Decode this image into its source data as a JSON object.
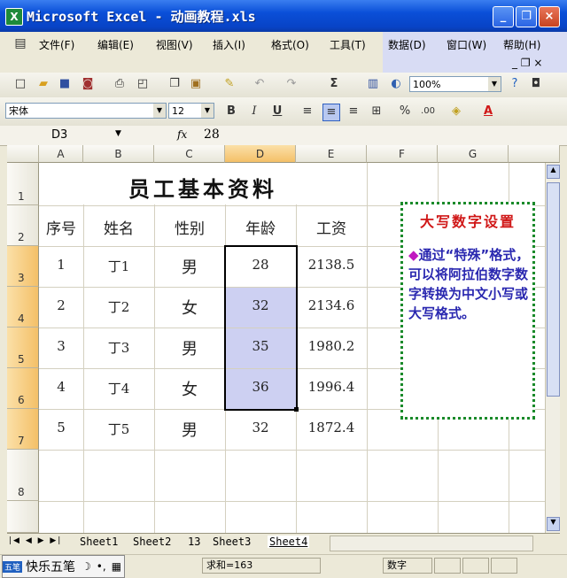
{
  "title": {
    "text": "Microsoft Excel - 动画教程.xls"
  },
  "window_controls": {
    "minimize": "_",
    "restore": "❐",
    "close": "×"
  },
  "menu": {
    "items": [
      "文件(F)",
      "编辑(E)",
      "视图(V)",
      "插入(I)",
      "格式(O)",
      "工具(T)",
      "数据(D)",
      "窗口(W)",
      "帮助(H)"
    ],
    "mdi_controls": "_ ❐ ×"
  },
  "standard_toolbar": {
    "zoom": "100%"
  },
  "format_toolbar": {
    "font": "宋体",
    "size": "12",
    "bold": "B",
    "italic": "I",
    "underline": "U"
  },
  "formula_bar": {
    "cell_ref": "D3",
    "fx": "fx",
    "value": "28"
  },
  "columns": [
    "A",
    "B",
    "C",
    "D",
    "E",
    "F",
    "G"
  ],
  "rows": [
    "1",
    "2",
    "3",
    "4",
    "5",
    "6",
    "7",
    "8"
  ],
  "sheet": {
    "title": "员工基本资料",
    "headers": [
      "序号",
      "姓名",
      "性别",
      "年龄",
      "工资"
    ],
    "records": [
      [
        "1",
        "丁1",
        "男",
        "28",
        "2138.5"
      ],
      [
        "2",
        "丁2",
        "女",
        "32",
        "2134.6"
      ],
      [
        "3",
        "丁3",
        "男",
        "35",
        "1980.2"
      ],
      [
        "4",
        "丁4",
        "女",
        "36",
        "1996.4"
      ],
      [
        "5",
        "丁5",
        "男",
        "32",
        "1872.4"
      ]
    ]
  },
  "note": {
    "title": "大写数字设置",
    "body": "通过“特殊”格式，可以将阿拉伯数字数字转换为中文小写或大写格式。",
    "diamond": "◆"
  },
  "sheet_tabs": [
    "Sheet1",
    "Sheet2",
    "13",
    "Sheet3",
    "Sheet4"
  ],
  "active_tab": "Sheet4",
  "status": {
    "sum": "求和=163",
    "mode": "数字"
  },
  "ime": {
    "label": "快乐五笔"
  }
}
